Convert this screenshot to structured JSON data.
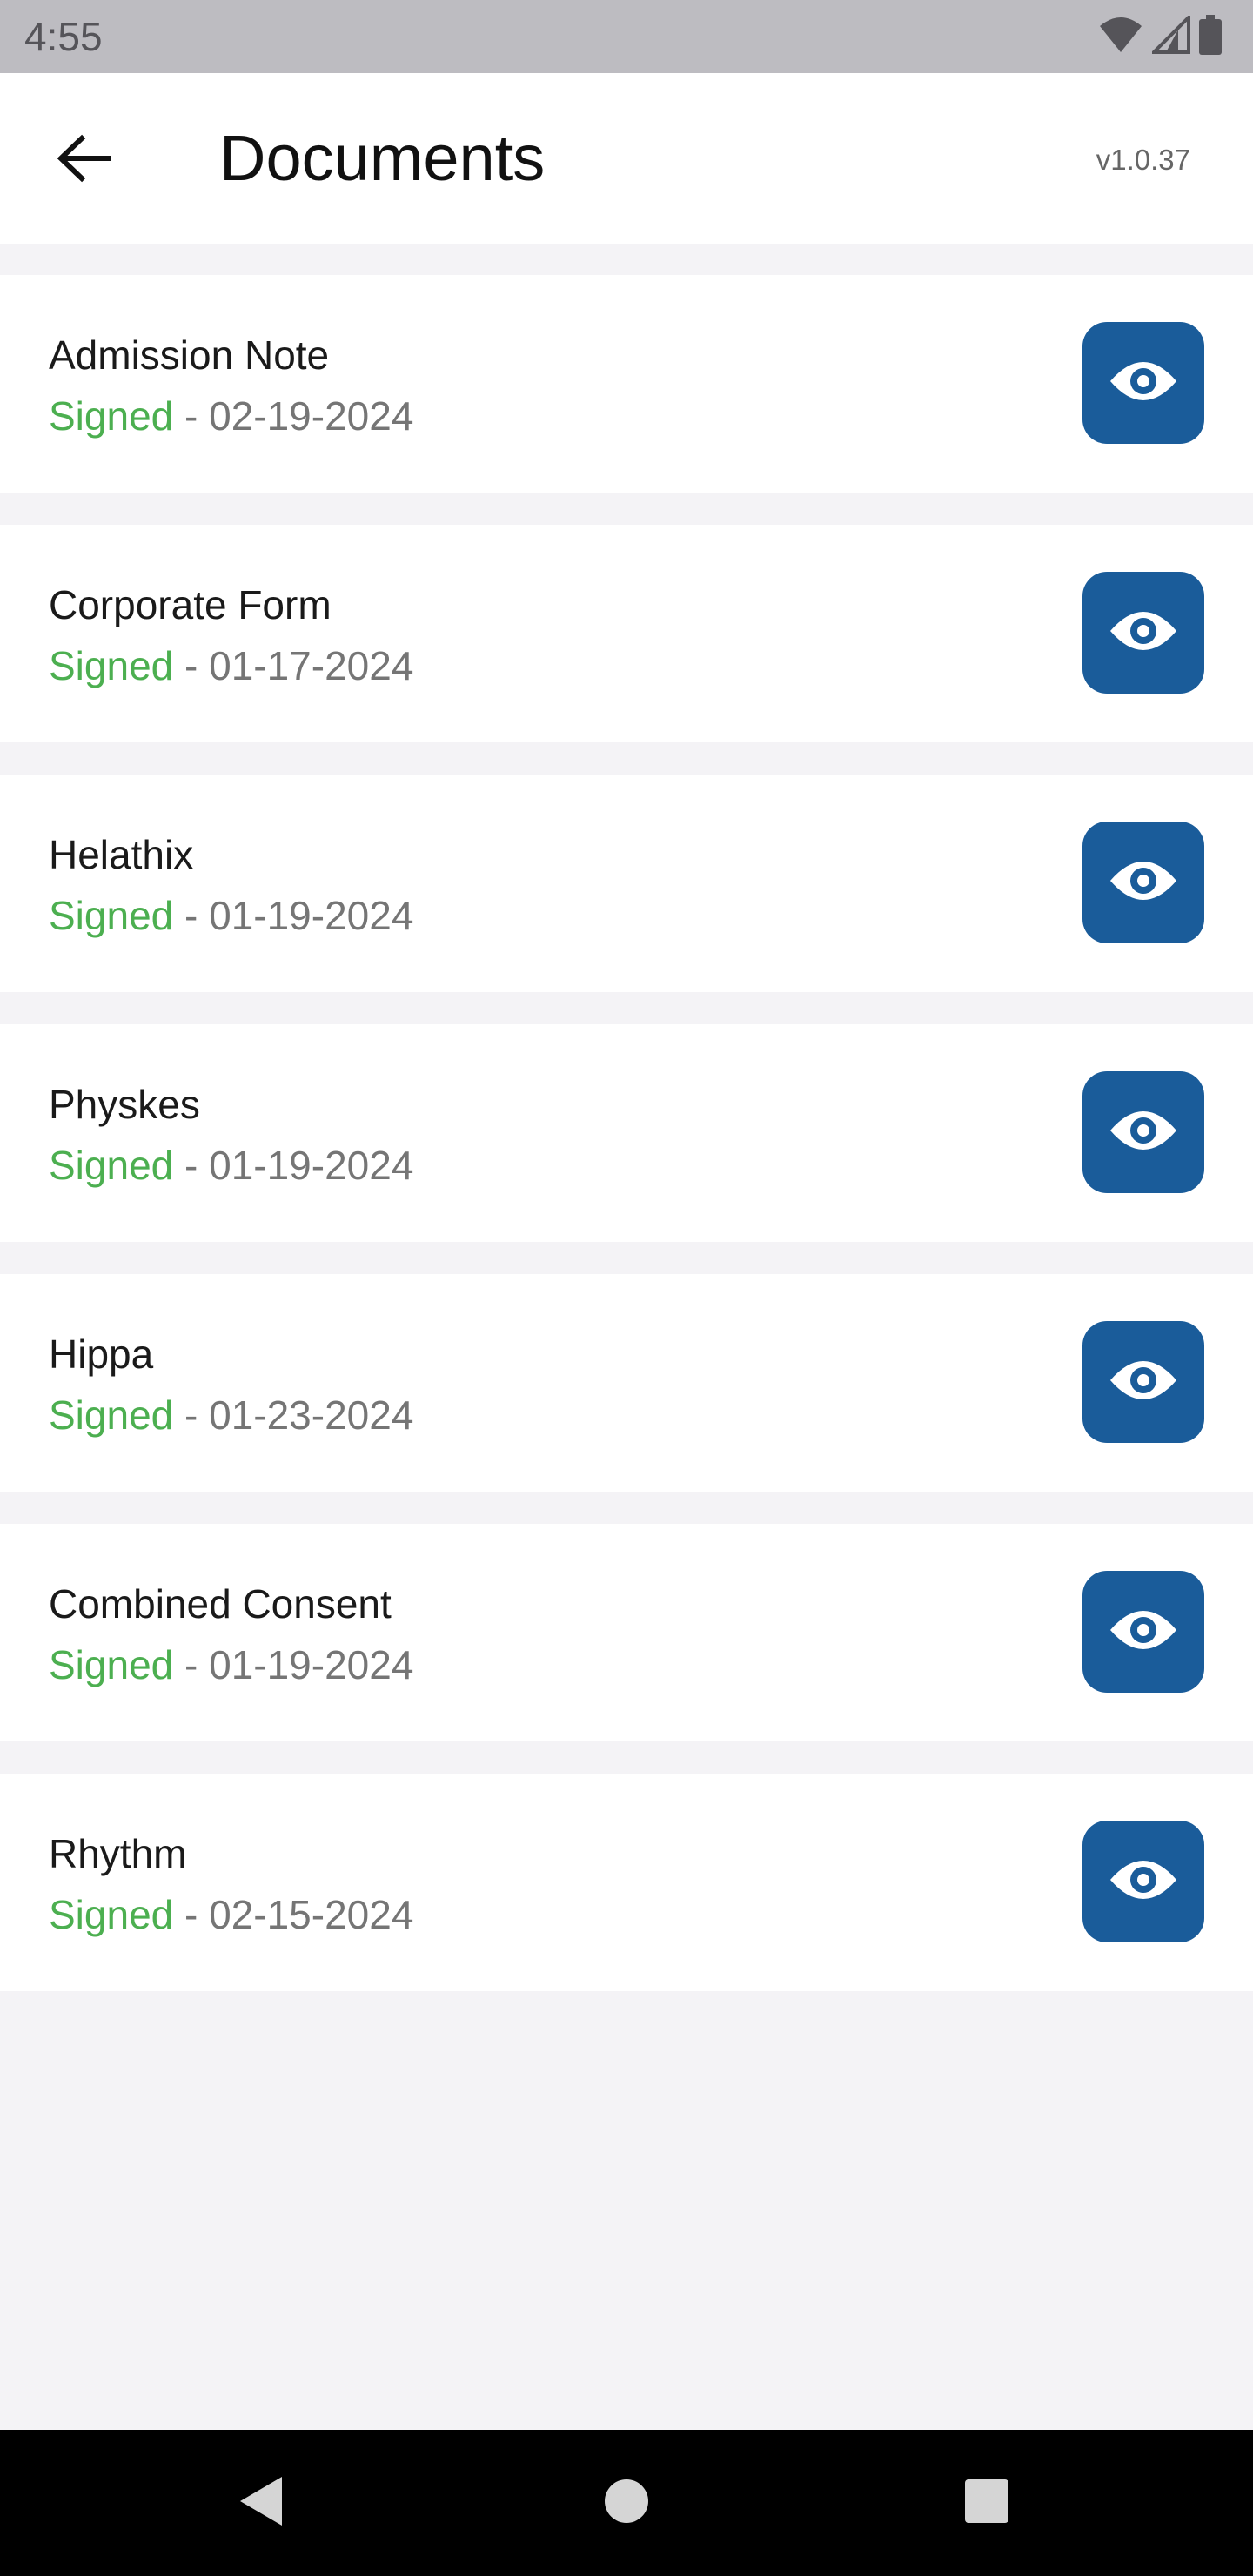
{
  "status_bar": {
    "time": "4:55",
    "icons": [
      "wifi-icon",
      "cell-signal-icon",
      "battery-icon"
    ]
  },
  "header": {
    "back_icon": "arrow-back-icon",
    "title": "Documents",
    "version": "v1.0.37"
  },
  "documents": [
    {
      "name": "Admission Note",
      "status": "Signed",
      "date": " - 02-19-2024"
    },
    {
      "name": "Corporate Form",
      "status": "Signed",
      "date": " - 01-17-2024"
    },
    {
      "name": "Helathix",
      "status": "Signed",
      "date": " - 01-19-2024"
    },
    {
      "name": "Physkes",
      "status": "Signed",
      "date": " - 01-19-2024"
    },
    {
      "name": "Hippa",
      "status": "Signed",
      "date": " - 01-23-2024"
    },
    {
      "name": "Combined Consent",
      "status": "Signed",
      "date": " - 01-19-2024"
    },
    {
      "name": "Rhythm",
      "status": "Signed",
      "date": " - 02-15-2024"
    }
  ],
  "view_icon": "eye-icon",
  "colors": {
    "accent": "#1a5c9a",
    "signed": "#4caf50",
    "date": "#757575",
    "background": "#f4f3f6"
  },
  "nav_bar": {
    "icons": [
      "nav-back-icon",
      "nav-home-icon",
      "nav-recents-icon"
    ]
  }
}
